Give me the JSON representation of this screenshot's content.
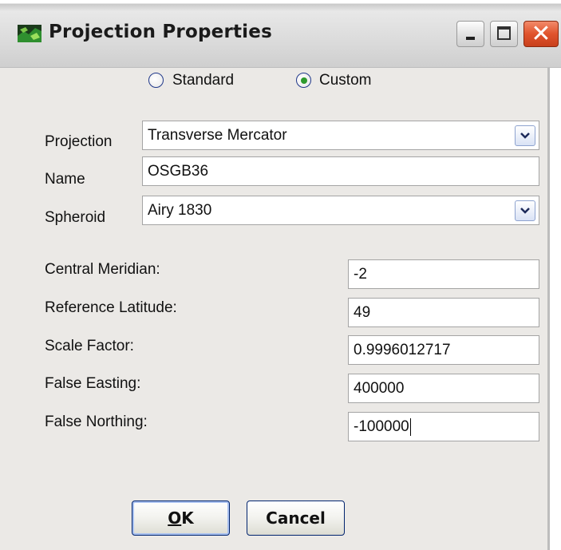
{
  "window": {
    "title": "Projection Properties",
    "icon": "map-app-icon",
    "controls": {
      "minimize": "minimize-icon",
      "maximize": "maximize-icon",
      "close": "close-icon"
    }
  },
  "mode": {
    "options": [
      {
        "label": "Standard",
        "selected": false
      },
      {
        "label": "Custom",
        "selected": true
      }
    ]
  },
  "form": {
    "projection": {
      "label": "Projection",
      "value": "Transverse Mercator"
    },
    "name": {
      "label": "Name",
      "value": "OSGB36"
    },
    "spheroid": {
      "label": "Spheroid",
      "value": "Airy 1830"
    }
  },
  "params": [
    {
      "label": "Central Meridian:",
      "value": "-2"
    },
    {
      "label": "Reference Latitude:",
      "value": "49"
    },
    {
      "label": "Scale Factor:",
      "value": "0.9996012717"
    },
    {
      "label": "False Easting:",
      "value": "400000"
    },
    {
      "label": "False Northing:",
      "value": "-100000"
    }
  ],
  "buttons": {
    "ok_mnemonic": "O",
    "ok_rest": "K",
    "cancel": "Cancel"
  },
  "colors": {
    "accent_blue": "#20388a",
    "radio_dot": "#2d9a2d",
    "close_red": "#e0532c"
  }
}
